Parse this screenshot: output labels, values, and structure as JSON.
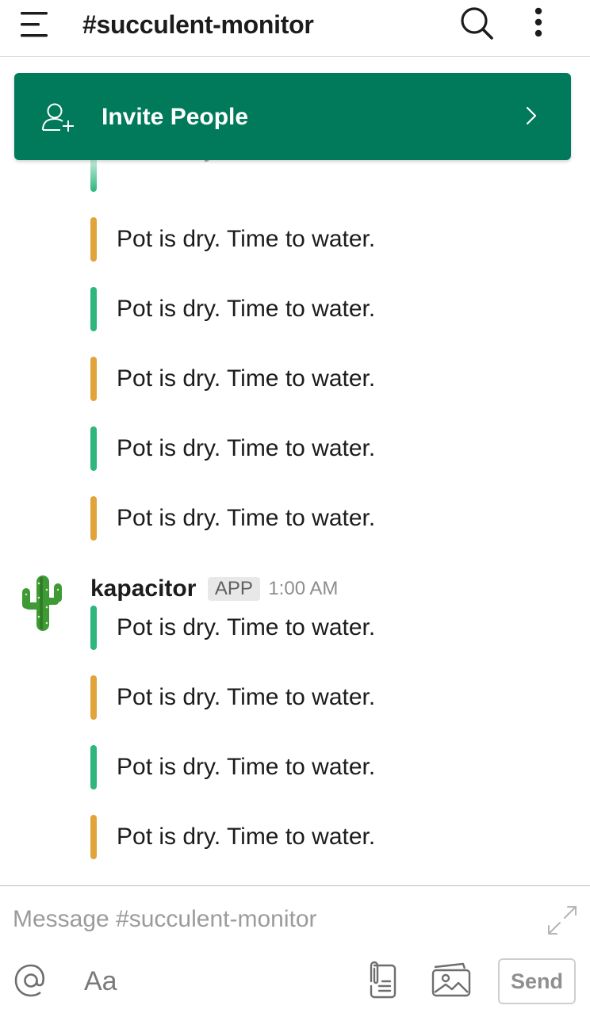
{
  "header": {
    "channel_title": "#succulent-monitor",
    "icons": [
      "menu-icon",
      "search-icon",
      "more-vertical-icon"
    ]
  },
  "invite_banner": {
    "label": "Invite People",
    "icons": [
      "add-person-icon",
      "chevron-right-icon"
    ],
    "background": "#007a5a"
  },
  "colors": {
    "attachment_green": "#2eb67d",
    "attachment_yellow": "#e0a43a"
  },
  "earlier_attachments": [
    {
      "text": "Pot is dry. Time to water.",
      "color": "green",
      "faded": true
    },
    {
      "text": "Pot is dry. Time to water.",
      "color": "yellow"
    },
    {
      "text": "Pot is dry. Time to water.",
      "color": "green"
    },
    {
      "text": "Pot is dry. Time to water.",
      "color": "yellow"
    },
    {
      "text": "Pot is dry. Time to water.",
      "color": "green"
    },
    {
      "text": "Pot is dry. Time to water.",
      "color": "yellow"
    }
  ],
  "message": {
    "sender": "kapacitor",
    "badge": "APP",
    "time": "1:00 AM",
    "avatar_icon": "cactus-avatar-icon",
    "attachments": [
      {
        "text": "Pot is dry. Time to water.",
        "color": "green"
      },
      {
        "text": "Pot is dry. Time to water.",
        "color": "yellow"
      },
      {
        "text": "Pot is dry. Time to water.",
        "color": "green"
      },
      {
        "text": "Pot is dry. Time to water.",
        "color": "yellow"
      }
    ]
  },
  "composer": {
    "placeholder": "Message #succulent-monitor",
    "value": "",
    "format_label": "Aa",
    "send_label": "Send",
    "icons": [
      "expand-icon",
      "mention-icon",
      "file-icon",
      "image-icon"
    ]
  }
}
